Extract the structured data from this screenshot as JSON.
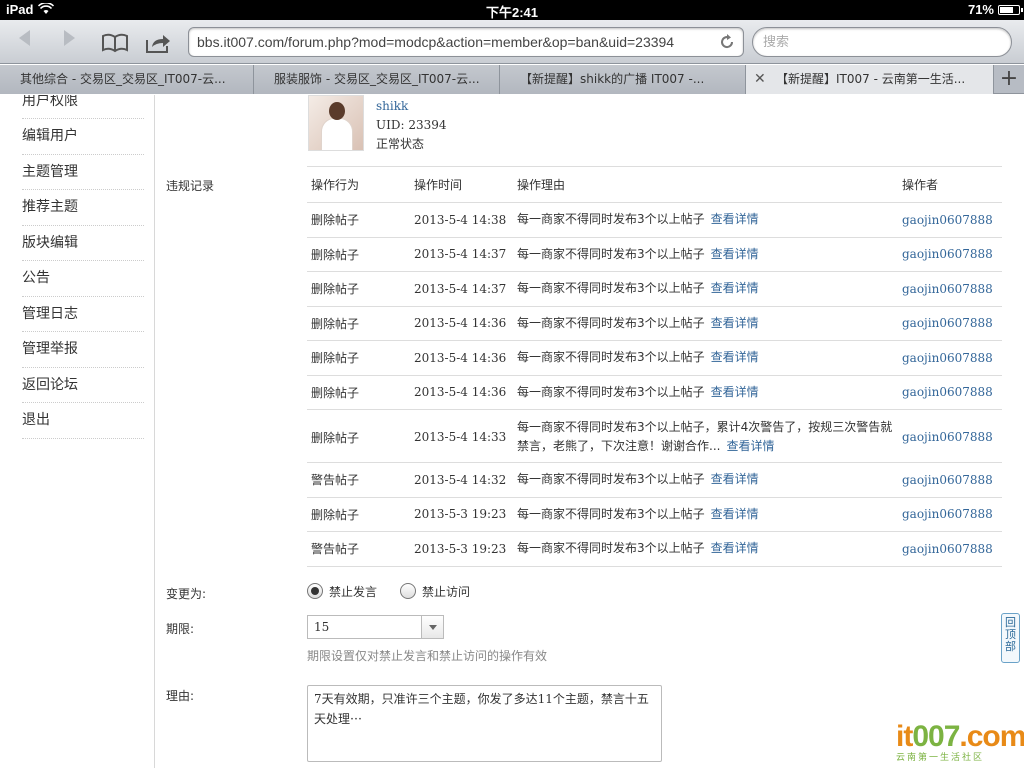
{
  "status": {
    "device": "iPad",
    "time": "下午2:41",
    "battery": "71%",
    "battery_level": 0.71
  },
  "browser": {
    "url": "bbs.it007.com/forum.php?mod=modcp&action=member&op=ban&uid=23394",
    "search_placeholder": "搜索",
    "tabs": [
      {
        "label": "其他综合 - 交易区_交易区_IT007-云..."
      },
      {
        "label": "服装服饰 - 交易区_交易区_IT007-云..."
      },
      {
        "label": "【新提醒】shikk的广播 IT007 -..."
      },
      {
        "label": "【新提醒】IT007 - 云南第一生活..."
      }
    ],
    "close_glyph": "✕",
    "newtab_glyph": "+"
  },
  "sidebar": {
    "items": [
      "用户权限",
      "编辑用户",
      "主题管理",
      "推荐主题",
      "版块编辑",
      "公告",
      "管理日志",
      "管理举报",
      "返回论坛",
      "退出"
    ]
  },
  "user": {
    "name": "shikk",
    "uid": "UID: 23394",
    "status": "正常状态"
  },
  "records": {
    "label": "违规记录",
    "headers": [
      "操作行为",
      "操作时间",
      "操作理由",
      "操作者"
    ],
    "detail_label": "查看详情",
    "rows": [
      {
        "action": "删除帖子",
        "time": "2013-5-4 14:38",
        "reason": "每一商家不得同时发布3个以上帖子",
        "operator": "gaojin0607888"
      },
      {
        "action": "删除帖子",
        "time": "2013-5-4 14:37",
        "reason": "每一商家不得同时发布3个以上帖子",
        "operator": "gaojin0607888"
      },
      {
        "action": "删除帖子",
        "time": "2013-5-4 14:37",
        "reason": "每一商家不得同时发布3个以上帖子",
        "operator": "gaojin0607888"
      },
      {
        "action": "删除帖子",
        "time": "2013-5-4 14:36",
        "reason": "每一商家不得同时发布3个以上帖子",
        "operator": "gaojin0607888"
      },
      {
        "action": "删除帖子",
        "time": "2013-5-4 14:36",
        "reason": "每一商家不得同时发布3个以上帖子",
        "operator": "gaojin0607888"
      },
      {
        "action": "删除帖子",
        "time": "2013-5-4 14:36",
        "reason": "每一商家不得同时发布3个以上帖子",
        "operator": "gaojin0607888"
      },
      {
        "action": "删除帖子",
        "time": "2013-5-4 14:33",
        "reason": "每一商家不得同时发布3个以上帖子，累计4次警告了，按规三次警告就禁言，老熊了，下次注意！谢谢合作...",
        "operator": "gaojin0607888"
      },
      {
        "action": "警告帖子",
        "time": "2013-5-4 14:32",
        "reason": "每一商家不得同时发布3个以上帖子",
        "operator": "gaojin0607888"
      },
      {
        "action": "删除帖子",
        "time": "2013-5-3 19:23",
        "reason": "每一商家不得同时发布3个以上帖子",
        "operator": "gaojin0607888"
      },
      {
        "action": "警告帖子",
        "time": "2013-5-3 19:23",
        "reason": "每一商家不得同时发布3个以上帖子",
        "operator": "gaojin0607888"
      }
    ]
  },
  "form": {
    "change_label": "变更为:",
    "option_ban_post": "禁止发言",
    "option_ban_visit": "禁止访问",
    "selected": "禁止发言",
    "period_label": "期限:",
    "period_value": "15",
    "period_hint": "期限设置仅对禁止发言和禁止访问的操作有效",
    "reason_label": "理由:",
    "reason_value": "7天有效期，只准许三个主题，你发了多达11个主题，禁言十五天处理⋯"
  },
  "back_to_top": "回顶部",
  "watermark": {
    "logo_a": "it",
    "logo_b": "007",
    "logo_c": ".com",
    "slogan": "云南第一生活社区"
  },
  "colors": {
    "link": "#336699",
    "watermark_orange": "#e88a17",
    "watermark_green": "#7cb342"
  }
}
